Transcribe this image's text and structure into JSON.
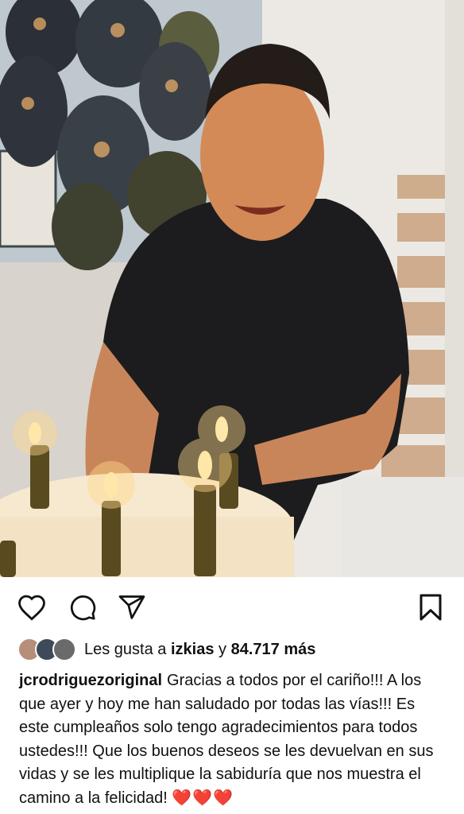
{
  "post": {
    "photo_alt": "",
    "actions": {
      "like": "heart-icon",
      "comment": "comment-icon",
      "share": "send-icon",
      "save": "bookmark-icon"
    },
    "likes": {
      "prefix": "Les gusta a",
      "user": "izkias",
      "joiner": "y",
      "count": "84.717 más"
    },
    "caption": {
      "username": "jcrodriguezoriginal",
      "text": "Gracias a todos por el cariño!!! A los que ayer y hoy me han saludado por todas las vías!!! Es este cumpleaños solo tengo agradecimientos para todos ustedes!!! Que los buenos deseos se les devuelvan en sus vidas y se les multiplique la sabiduría que nos muestra el camino a la felicidad!",
      "emoji": "❤️❤️❤️"
    },
    "colors": {
      "heart": "#e0245e",
      "text": "#111111"
    }
  }
}
